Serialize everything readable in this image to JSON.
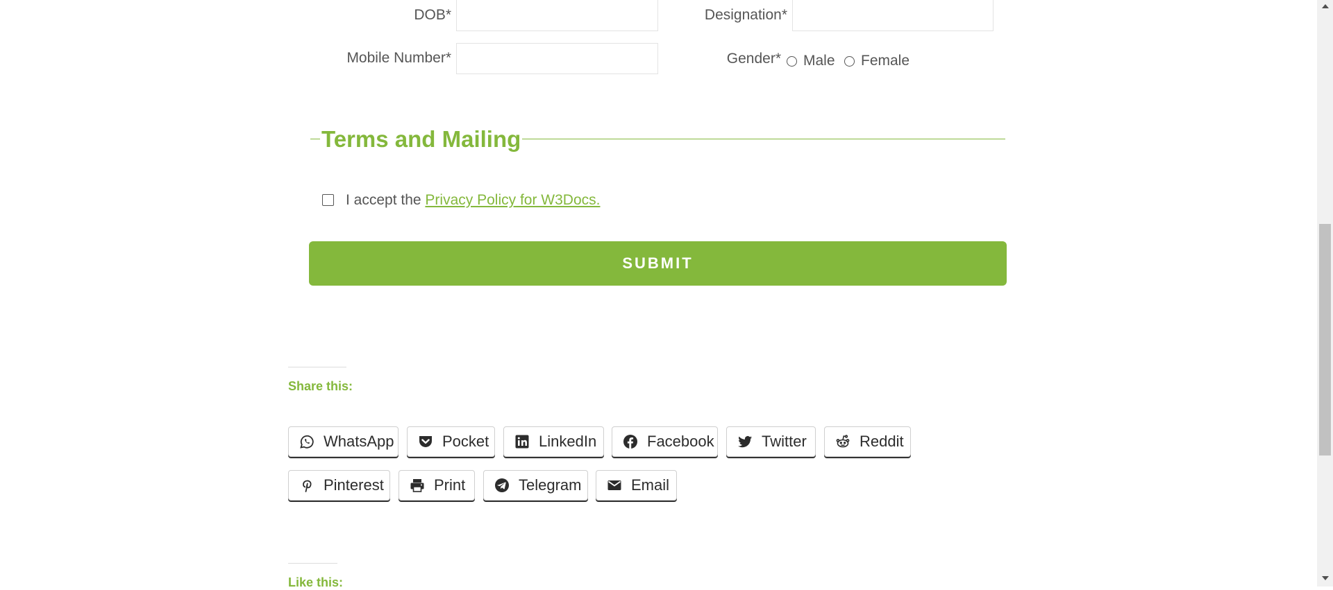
{
  "form": {
    "dob_label": "DOB*",
    "designation_label": "Designation*",
    "mobile_label": "Mobile Number*",
    "gender_label": "Gender*",
    "gender_options": [
      "Male",
      "Female"
    ],
    "dob_value": "",
    "designation_value": "",
    "mobile_value": ""
  },
  "terms": {
    "title": "Terms and Mailing",
    "accept_prefix": "I accept the",
    "link_text": "Privacy Policy for W3Docs."
  },
  "submit_label": "SUBMIT",
  "share": {
    "heading": "Share this:",
    "buttons": [
      {
        "label": "WhatsApp",
        "icon": "whatsapp-icon"
      },
      {
        "label": "Pocket",
        "icon": "pocket-icon"
      },
      {
        "label": "LinkedIn",
        "icon": "linkedin-icon"
      },
      {
        "label": "Facebook",
        "icon": "facebook-icon"
      },
      {
        "label": "Twitter",
        "icon": "twitter-icon"
      },
      {
        "label": "Reddit",
        "icon": "reddit-icon"
      },
      {
        "label": "Pinterest",
        "icon": "pinterest-icon"
      },
      {
        "label": "Print",
        "icon": "print-icon"
      },
      {
        "label": "Telegram",
        "icon": "telegram-icon"
      },
      {
        "label": "Email",
        "icon": "email-icon"
      }
    ]
  },
  "like": {
    "heading": "Like this:"
  },
  "colors": {
    "accent": "#84b83c",
    "text": "#555555"
  }
}
